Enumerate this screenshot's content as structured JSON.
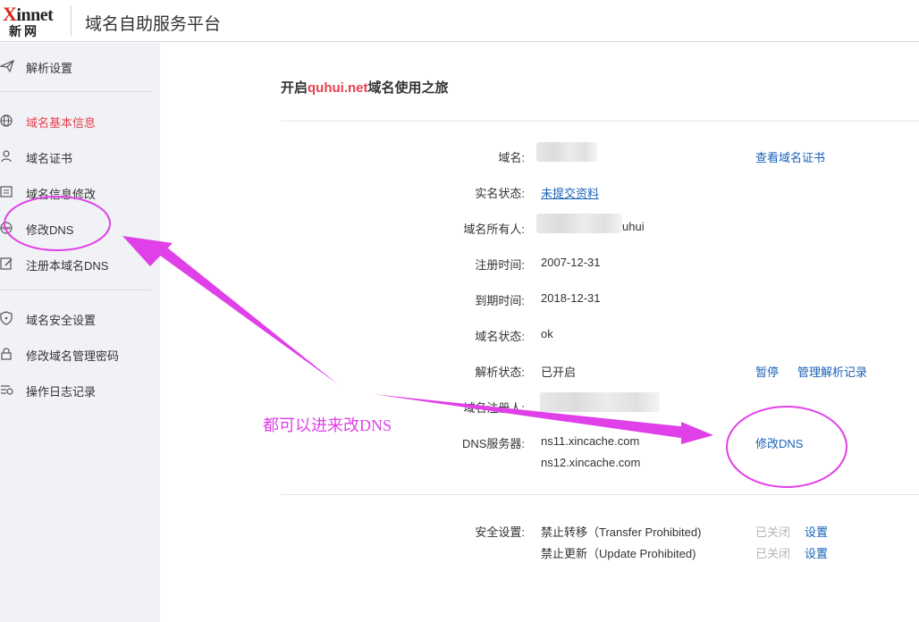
{
  "header": {
    "logo_top": "innet",
    "logo_x": "X",
    "logo_bottom": "新网",
    "title": "域名自助服务平台"
  },
  "sidebar": {
    "items": [
      {
        "label": "解析设置",
        "icon": "paper-plane-icon"
      },
      {
        "label": "域名基本信息",
        "icon": "globe-icon",
        "active": true
      },
      {
        "label": "域名证书",
        "icon": "certificate-icon"
      },
      {
        "label": "域名信息修改",
        "icon": "id-card-icon"
      },
      {
        "label": "修改DNS",
        "icon": "dns-globe-icon"
      },
      {
        "label": "注册本域名DNS",
        "icon": "edit-icon"
      },
      {
        "label": "域名安全设置",
        "icon": "shield-icon"
      },
      {
        "label": "修改域名管理密码",
        "icon": "lock-icon"
      },
      {
        "label": "操作日志记录",
        "icon": "log-list-icon"
      }
    ]
  },
  "main": {
    "title_prefix": "开启",
    "title_domain": "quhui.net",
    "title_suffix": "域名使用之旅",
    "rows": {
      "domain": {
        "label": "域名:",
        "link": "查看域名证书"
      },
      "realname": {
        "label": "实名状态:",
        "value": "未提交资料"
      },
      "owner": {
        "label": "域名所有人:",
        "value_tail": "uhui"
      },
      "reg_time": {
        "label": "注册时间:",
        "value": "2007-12-31"
      },
      "exp_time": {
        "label": "到期时间:",
        "value": "2018-12-31"
      },
      "status": {
        "label": "域名状态:",
        "value": "ok"
      },
      "resolve": {
        "label": "解析状态:",
        "value": "已开启",
        "pause": "暂停",
        "manage": "管理解析记录"
      },
      "registrant": {
        "label": "域名注册人:"
      },
      "dns": {
        "label": "DNS服务器:",
        "ns1": "ns11.xincache.com",
        "ns2": "ns12.xincache.com",
        "modify": "修改DNS"
      }
    },
    "security": {
      "label": "安全设置:",
      "items": [
        {
          "name": "禁止转移（Transfer Prohibited)",
          "state": "已关闭",
          "action": "设置"
        },
        {
          "name": "禁止更新（Update Prohibited)",
          "state": "已关闭",
          "action": "设置"
        }
      ]
    }
  },
  "annotation": {
    "text": "都可以进来改DNS",
    "color": "#e040e8"
  },
  "colors": {
    "accent_red": "#e8414e",
    "link_blue": "#1a62b8",
    "sidebar_bg": "#f0f2f5"
  }
}
